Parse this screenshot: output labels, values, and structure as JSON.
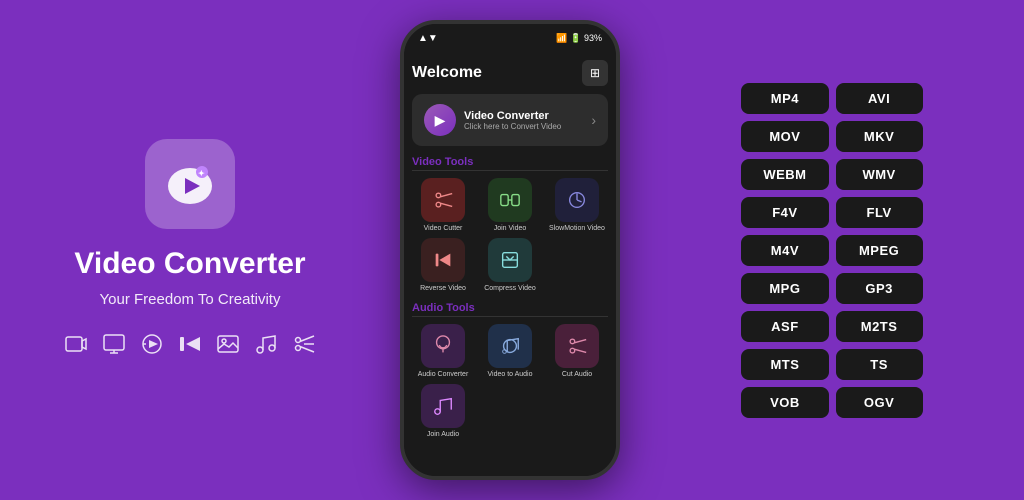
{
  "left": {
    "app_title": "Video Converter",
    "app_subtitle": "Your Freedom To Creativity",
    "feature_icons": [
      "📹",
      "🎬",
      "⏩",
      "⏮",
      "🖼",
      "🎵",
      "✂"
    ]
  },
  "phone": {
    "status_time": "▲▼ 93%",
    "header_title": "Welcome",
    "banner": {
      "title": "Video Converter",
      "subtitle": "Click here to Convert Video"
    },
    "video_tools_label": "Video Tools",
    "video_tools": [
      {
        "label": "Video Cutter",
        "color": "#4a2c2c",
        "icon": "✂"
      },
      {
        "label": "Join Video",
        "color": "#2c3a2c",
        "icon": "🔗"
      },
      {
        "label": "SlowMotion Video",
        "color": "#2c2c3a",
        "icon": "⏱"
      },
      {
        "label": "Reverse Video",
        "color": "#3a2c2c",
        "icon": "⏪"
      },
      {
        "label": "Compress Video",
        "color": "#2c3a3a",
        "icon": "📦"
      }
    ],
    "audio_tools_label": "Audio Tools",
    "audio_tools": [
      {
        "label": "Audio Converter",
        "color": "#3a2c4a",
        "icon": "🎧"
      },
      {
        "label": "Video to Audio",
        "color": "#2c3a4a",
        "icon": "🎵"
      },
      {
        "label": "Cut Audio",
        "color": "#4a2c3a",
        "icon": "✂"
      },
      {
        "label": "Join Audio",
        "color": "#3a2c4a",
        "icon": "🔗"
      }
    ]
  },
  "formats": {
    "items": [
      "MP4",
      "AVI",
      "MOV",
      "MKV",
      "WEBM",
      "WMV",
      "F4V",
      "FLV",
      "M4V",
      "MPEG",
      "MPG",
      "GP3",
      "ASF",
      "M2TS",
      "MTS",
      "TS",
      "VOB",
      "OGV"
    ]
  }
}
